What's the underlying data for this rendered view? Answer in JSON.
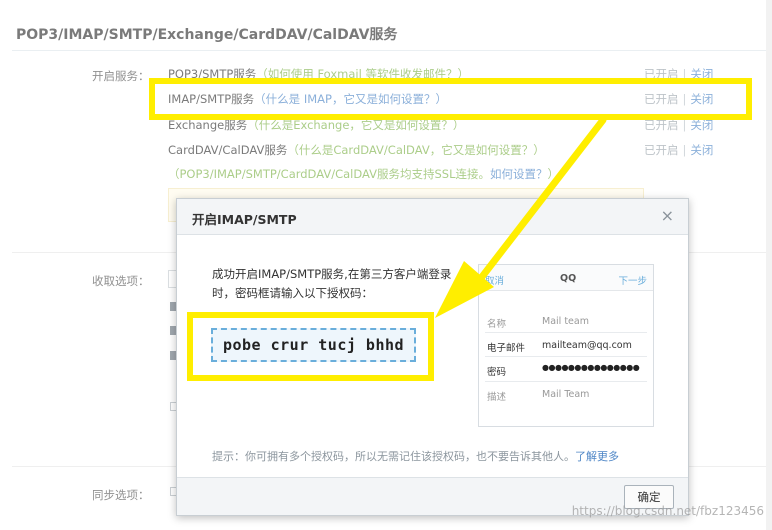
{
  "section_title": "POP3/IMAP/SMTP/Exchange/CardDAV/CalDAV服务",
  "enable_label": "开启服务：",
  "services": [
    {
      "name": "POP3/SMTP服务",
      "hint": "（如何使用 Foxmail 等软件收发邮件？）",
      "status": "已开启",
      "sep": "|",
      "action": "关闭"
    },
    {
      "name": "IMAP/SMTP服务",
      "hint": "（什么是 IMAP，它又是如何设置？）",
      "status": "已开启",
      "sep": "|",
      "action": "关闭"
    },
    {
      "name": "Exchange服务",
      "hint": "（什么是Exchange，它又是如何设置？）",
      "status": "已开启",
      "sep": "|",
      "action": "关闭"
    },
    {
      "name": "CardDAV/CalDAV服务",
      "hint": "（什么是CardDAV/CalDAV，它又是如何设置？）",
      "status": "已开启",
      "sep": "|",
      "action": "关闭"
    }
  ],
  "ssl_note": "（POP3/IMAP/SMTP/CardDAV/CalDAV服务均支持SSL连接。",
  "ssl_link": "如何设置？",
  "ssl_note_end": "）",
  "receive_label": "收取选项：",
  "sync_label": "同步选项：",
  "dialog": {
    "title": "开启IMAP/SMTP",
    "close": "×",
    "message": "成功开启IMAP/SMTP服务,在第三方客户端登录时，密码框请输入以下授权码：",
    "auth_code": "pobe crur tucj bhhd",
    "phone": {
      "cancel": "取消",
      "title": "QQ",
      "next": "下一步",
      "rows": [
        {
          "label": "名称",
          "value": "Mail team"
        },
        {
          "label": "电子邮件",
          "value": "mailteam@qq.com"
        },
        {
          "label": "密码",
          "value": "●●●●●●●●●●●●●●●"
        },
        {
          "label": "描述",
          "value": "Mail Team"
        }
      ]
    },
    "tip": "提示：你可拥有多个授权码，所以无需记住该授权码，也不要告诉其他人。",
    "tip_link": "了解更多",
    "ok": "确定"
  },
  "watermark": "https://blog.csdn.net/fbz123456",
  "colors": {
    "highlight": "#ffee00",
    "link": "#4e86c6",
    "hint": "#7fb34a"
  }
}
